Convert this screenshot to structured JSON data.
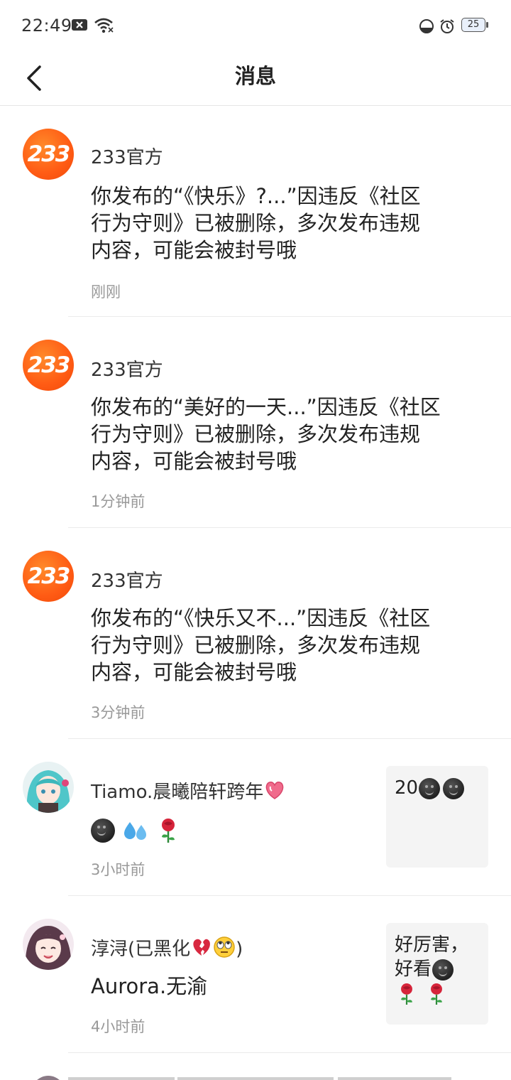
{
  "status_bar": {
    "time": "22:49",
    "battery": "25"
  },
  "header": {
    "title": "消息"
  },
  "messages": [
    {
      "sender": "233官方",
      "avatar": "233",
      "body_lines": [
        "你发布的“《快乐》?...”因违反《社区",
        "行为守则》已被删除，多次发布违规",
        "内容，可能会被封号哦"
      ],
      "time": "刚刚"
    },
    {
      "sender": "233官方",
      "avatar": "233",
      "body_lines": [
        "你发布的“美好的一天...”因违反《社区",
        "行为守则》已被删除，多次发布违规",
        "内容，可能会被封号哦"
      ],
      "time": "1分钟前"
    },
    {
      "sender": "233官方",
      "avatar": "233",
      "body_lines": [
        "你发布的“《快乐又不...”因违反《社区",
        "行为守则》已被删除，多次发布违规",
        "内容，可能会被封号哦"
      ],
      "time": "3分钟前"
    },
    {
      "sender": "Tiamo.晨曦陪轩跨年",
      "sender_emoji": "heart-icon",
      "body_icons": [
        "dark-smile-emoji",
        "sweat-drops-emoji",
        "rose-emoji"
      ],
      "time": "3小时前",
      "quote_text": "20",
      "quote_icons": [
        "dark-smile-emoji",
        "dark-smile-emoji"
      ]
    },
    {
      "sender": "淳浔(已黑化",
      "sender_suffix": ")",
      "sender_emoji": [
        "broken-heart-icon",
        "eye-roll-emoji"
      ],
      "body": "Aurora.无渝",
      "time": "4小时前",
      "quote_lines": [
        "好厉害，",
        "好看"
      ],
      "quote_icons": [
        "dark-smile-emoji",
        "rose-emoji",
        "rose-emoji"
      ]
    }
  ],
  "colors": {
    "accent_logo": "#ff5b14",
    "time_gray": "#999999",
    "quote_bg": "#f4f4f4"
  }
}
